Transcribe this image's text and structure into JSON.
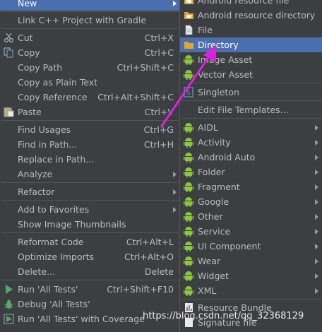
{
  "left_menu": {
    "new": "New",
    "link": "Link C++ Project with Gradle",
    "cut": {
      "label": "Cut",
      "shortcut": "Ctrl+X"
    },
    "copy": {
      "label": "Copy",
      "shortcut": "Ctrl+C"
    },
    "copy_path": {
      "label": "Copy Path",
      "shortcut": "Ctrl+Shift+C"
    },
    "copy_plain": {
      "label": "Copy as Plain Text"
    },
    "copy_ref": {
      "label": "Copy Reference",
      "shortcut": "Ctrl+Alt+Shift+C"
    },
    "paste": {
      "label": "Paste",
      "shortcut": "Ctrl+V"
    },
    "find_usages": {
      "label": "Find Usages",
      "shortcut": "Ctrl+G"
    },
    "find_in_path": {
      "label": "Find in Path...",
      "shortcut": "Ctrl+H"
    },
    "replace_in_path": {
      "label": "Replace in Path..."
    },
    "analyze": {
      "label": "Analyze"
    },
    "refactor": {
      "label": "Refactor"
    },
    "add_fav": {
      "label": "Add to Favorites"
    },
    "show_thumbs": {
      "label": "Show Image Thumbnails"
    },
    "reformat": {
      "label": "Reformat Code",
      "shortcut": "Ctrl+Alt+L"
    },
    "optimize": {
      "label": "Optimize Imports",
      "shortcut": "Ctrl+Alt+O"
    },
    "delete": {
      "label": "Delete...",
      "shortcut": "Delete"
    },
    "run_tests": {
      "label": "Run 'All Tests'",
      "shortcut": "Ctrl+Shift+F10"
    },
    "debug_tests": {
      "label": "Debug 'All Tests'"
    },
    "run_coverage": {
      "label": "Run 'All Tests' with Coverage"
    }
  },
  "right_menu": {
    "android_res_file": "Android resource file",
    "android_res_dir": "Android resource directory",
    "file": "File",
    "directory": "Directory",
    "image_asset": "Image Asset",
    "vector_asset": "Vector Asset",
    "singleton": "Singleton",
    "edit_templates": "Edit File Templates...",
    "aidl": "AIDL",
    "activity": "Activity",
    "android_auto": "Android Auto",
    "folder": "Folder",
    "fragment": "Fragment",
    "google": "Google",
    "other": "Other",
    "service": "Service",
    "ui_component": "UI Component",
    "wear": "Wear",
    "widget": "Widget",
    "xml": "XML",
    "resource_bundle": "Resource Bundle",
    "signature_file": "Signature file"
  },
  "watermark": "https://blog.csdn.net/qq_32368129",
  "colors": {
    "selection": "#4b6eaf",
    "background": "#3c3f41",
    "arrow": "#e020e0",
    "android_green": "#8cc63f"
  }
}
